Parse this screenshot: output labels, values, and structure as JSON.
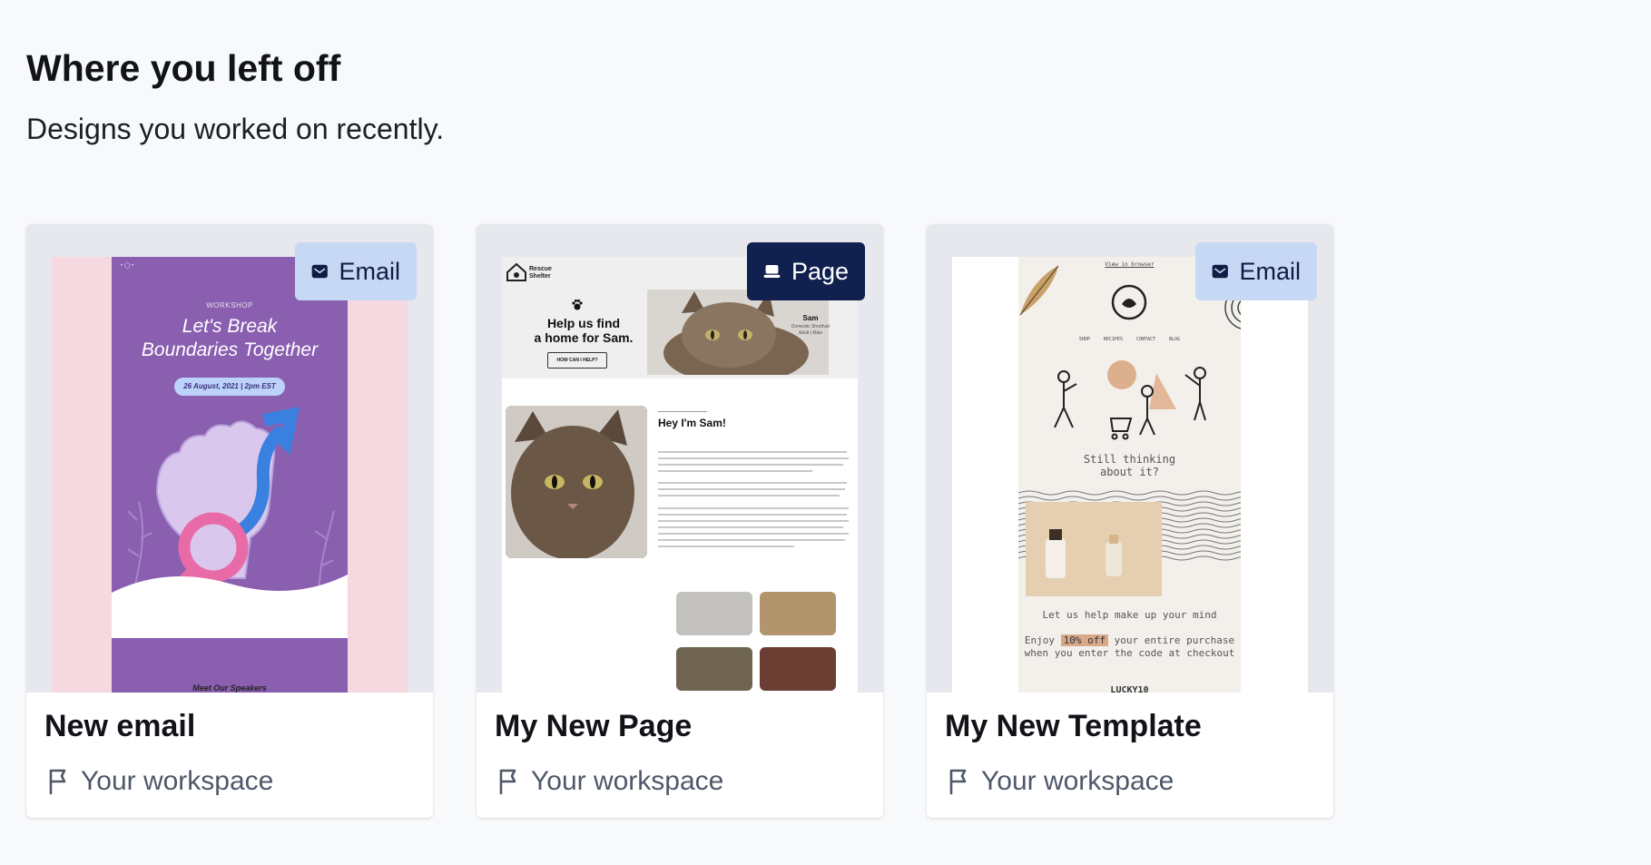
{
  "header": {
    "title": "Where you left off",
    "subtitle": "Designs you worked on recently."
  },
  "cards": [
    {
      "title": "New email",
      "workspace": "Your workspace",
      "badge": "Email",
      "badge_icon": "envelope-icon",
      "preview": {
        "kicker": "WORKSHOP",
        "title_line1": "Let's Break",
        "title_line2": "Boundaries Together",
        "date": "26 August, 2021 | 2pm EST",
        "footer": "Meet Our Speakers"
      }
    },
    {
      "title": "My New Page",
      "workspace": "Your workspace",
      "badge": "Page",
      "badge_icon": "laptop-icon",
      "preview": {
        "logo_line1": "Rescue",
        "logo_line2": "Shelter",
        "hero_line1": "Help us find",
        "hero_line2": "a home for Sam.",
        "cta": "HOW CAN I HELP?",
        "pet_name": "Sam",
        "pet_line1": "Domestic Shorthair",
        "pet_line2": "Adult | Male",
        "greeting": "Hey I'm Sam!"
      }
    },
    {
      "title": "My New Template",
      "workspace": "Your workspace",
      "badge": "Email",
      "badge_icon": "envelope-icon",
      "preview": {
        "view_link": "View in browser",
        "nav": "SHOP RECIPES CONTACT BLOG",
        "think_line1": "Still thinking",
        "think_line2": "about it?",
        "help": "Let us help make up your mind",
        "enjoy_pre": "Enjoy",
        "enjoy_highlight": "10% off",
        "enjoy_post": "your entire purchase when you enter the code at checkout",
        "code": "LUCKY10"
      }
    }
  ],
  "colors": {
    "background": "#f8f9fb",
    "badge_light": "#c6d8f4",
    "badge_dark": "#10204f",
    "muted_text": "#4f5869"
  }
}
